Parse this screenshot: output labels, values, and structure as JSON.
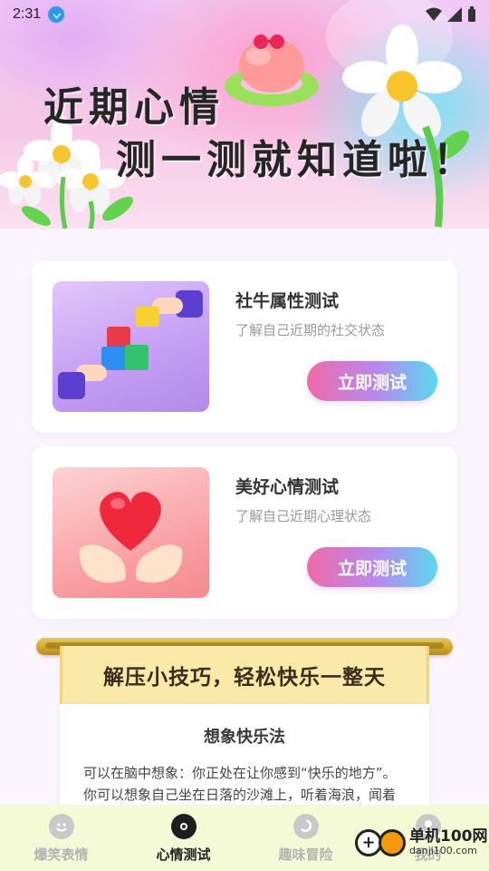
{
  "status_bar": {
    "time": "2:31"
  },
  "hero": {
    "title_line1": "近期心情",
    "title_line2": "测一测就知道啦！"
  },
  "cards": [
    {
      "title": "社牛属性测试",
      "desc": "了解自己近期的社交状态",
      "button": "立即测试"
    },
    {
      "title": "美好心情测试",
      "desc": "了解自己近期心理状态",
      "button": "立即测试"
    }
  ],
  "tips": {
    "banner": "解压小技巧，轻松快乐一整天",
    "heading": "想象快乐法",
    "body": "可以在脑中想象：你正处在让你感到“快乐的地方”。你可以想象自己坐在日落的沙滩上，听着海浪，闻着大海的味道，感受海风和温暖的沙"
  },
  "nav": {
    "items": [
      {
        "label": "爆笑表情",
        "icon": "smile-icon",
        "active": false
      },
      {
        "label": "心情测试",
        "icon": "flower-icon",
        "active": true
      },
      {
        "label": "趣味冒险",
        "icon": "swirl-icon",
        "active": false
      },
      {
        "label": "我的",
        "icon": "user-icon",
        "active": false
      }
    ]
  },
  "watermark": {
    "line1": "单机100网",
    "line2": "danji100.com"
  },
  "colors": {
    "button_gradient": [
      "#f06aa8",
      "#b48af0",
      "#59d9f0"
    ],
    "banner": "#fbe9a9",
    "nav_bg": "#f4f9d6"
  }
}
